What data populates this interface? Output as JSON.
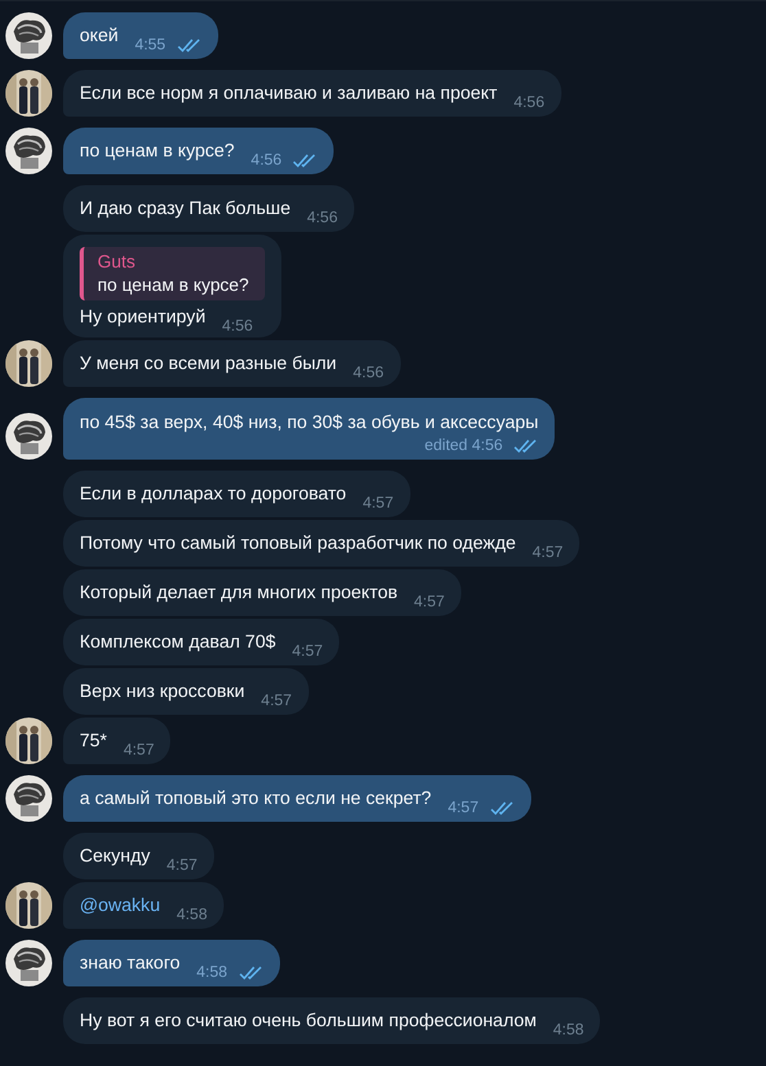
{
  "messages": [
    {
      "outgoing": true,
      "kind": "text",
      "text": "окей",
      "time": "4:55",
      "read": true,
      "avatar": true
    },
    {
      "outgoing": false,
      "kind": "text",
      "text": "Если все норм я оплачиваю и заливаю на проект",
      "time": "4:56",
      "avatar": true
    },
    {
      "outgoing": true,
      "kind": "text",
      "text": "по ценам в курсе?",
      "time": "4:56",
      "read": true,
      "avatar": true
    },
    {
      "outgoing": false,
      "kind": "text",
      "text": "И даю сразу Пак больше",
      "time": "4:56",
      "avatar": false
    },
    {
      "outgoing": false,
      "kind": "text",
      "text": "Ну ориентируй",
      "time": "4:56",
      "avatar": false,
      "reply": {
        "name": "Guts",
        "text": "по ценам в курсе?"
      }
    },
    {
      "outgoing": false,
      "kind": "text",
      "text": "У меня со всеми разные были",
      "time": "4:56",
      "avatar": true
    },
    {
      "outgoing": true,
      "kind": "text",
      "text": "по 45$ за верх, 40$ низ, по 30$ за обувь и аксессуары",
      "time": "4:56",
      "edited": "edited",
      "read": true,
      "avatar": true
    },
    {
      "outgoing": false,
      "kind": "text",
      "text": "Если в долларах то дороговато",
      "time": "4:57",
      "avatar": false
    },
    {
      "outgoing": false,
      "kind": "text",
      "text": "Потому что самый топовый разработчик по одежде",
      "time": "4:57",
      "avatar": false
    },
    {
      "outgoing": false,
      "kind": "text",
      "text": "Который делает для многих проектов",
      "time": "4:57",
      "avatar": false
    },
    {
      "outgoing": false,
      "kind": "text",
      "text": "Комплексом давал 70$",
      "time": "4:57",
      "avatar": false
    },
    {
      "outgoing": false,
      "kind": "text",
      "text": "Верх низ кроссовки",
      "time": "4:57",
      "avatar": false
    },
    {
      "outgoing": false,
      "kind": "text",
      "text": "75*",
      "time": "4:57",
      "avatar": true
    },
    {
      "outgoing": true,
      "kind": "text",
      "text": "а самый топовый это кто если не секрет?",
      "time": "4:57",
      "read": true,
      "avatar": true
    },
    {
      "outgoing": false,
      "kind": "text",
      "text": "Секунду",
      "time": "4:57",
      "avatar": false
    },
    {
      "outgoing": false,
      "kind": "mention",
      "text": "@owakku",
      "time": "4:58",
      "avatar": true
    },
    {
      "outgoing": true,
      "kind": "text",
      "text": "знаю такого",
      "time": "4:58",
      "read": true,
      "avatar": true
    },
    {
      "outgoing": false,
      "kind": "text",
      "text": "Ну вот я его считаю очень большим профессионалом",
      "time": "4:58",
      "avatar": false
    }
  ]
}
